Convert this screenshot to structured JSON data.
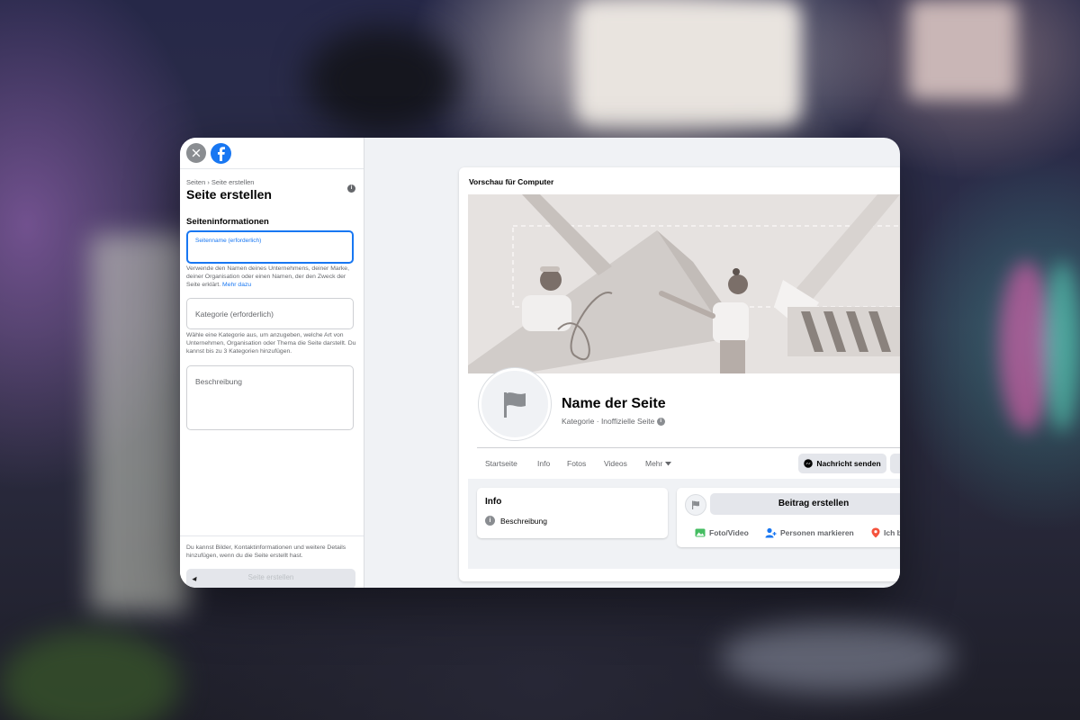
{
  "left_panel": {
    "breadcrumb": "Seiten › Seite erstellen",
    "title": "Seite erstellen",
    "section_title": "Seiteninformationen",
    "name_field": {
      "label": "Seitenname (erforderlich)",
      "value": ""
    },
    "name_help": "Verwende den Namen deines Unternehmens, deiner Marke, deiner Organisation oder einen Namen, der den Zweck der Seite erklärt.",
    "name_help_link": "Mehr dazu",
    "category_field": {
      "label": "Kategorie (erforderlich)"
    },
    "category_help": "Wähle eine Kategorie aus, um anzugeben, welche Art von Unternehmen, Organisation oder Thema die Seite darstellt. Du kannst bis zu 3 Kategorien hinzufügen.",
    "description_field": {
      "label": "Beschreibung"
    },
    "bottom_note": "Du kannst Bilder, Kontaktinformationen und weitere Details hinzufügen, wenn du die Seite erstellt hast.",
    "create_button": "Seite erstellen"
  },
  "preview": {
    "title": "Vorschau für Computer",
    "page_name": "Name der Seite",
    "page_sub": "Kategorie · Inoffizielle Seite",
    "tabs": [
      "Startseite",
      "Info",
      "Fotos",
      "Videos",
      "Mehr"
    ],
    "message_button": "Nachricht senden",
    "info_card": {
      "title": "Info",
      "row": "Beschreibung"
    },
    "post": {
      "button": "Beitrag erstellen",
      "actions": [
        "Foto/Video",
        "Personen markieren",
        "Ich b"
      ]
    }
  },
  "icons": {
    "close": "close-icon",
    "facebook": "facebook-logo-icon",
    "flag": "flag-icon",
    "messenger": "messenger-icon",
    "photo": "photo-icon",
    "people": "tag-people-icon",
    "location": "location-pin-icon"
  },
  "colors": {
    "accent": "#1877f2",
    "background": "#f0f2f5",
    "button_gray": "#e4e6eb",
    "text_secondary": "#65676b"
  }
}
